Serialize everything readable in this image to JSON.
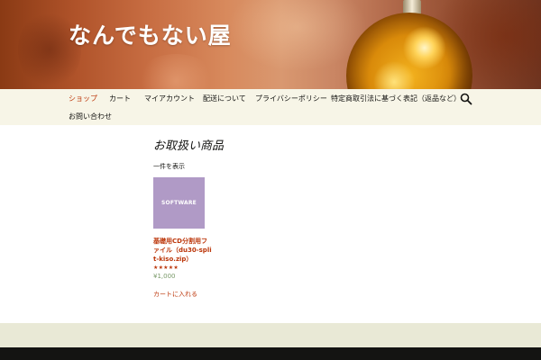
{
  "site": {
    "title": "なんでもない屋"
  },
  "nav": {
    "items": [
      {
        "label": "ショップ",
        "active": true
      },
      {
        "label": "カート"
      },
      {
        "label": "マイアカウント"
      },
      {
        "label": "配送について"
      },
      {
        "label": "プライバシーポリシー"
      },
      {
        "label": "特定商取引法に基づく表記（返品など）"
      },
      {
        "label": "お問い合わせ"
      }
    ],
    "search_icon": "search-icon"
  },
  "main": {
    "heading": "お取扱い商品",
    "result_count": "一件を表示",
    "products": [
      {
        "thumb_text": "SOFTWARE",
        "title": "基礎用CD分割用ファイル（du30-split-kiso.zip）",
        "rating_stars": "★★★★★",
        "rating_value": 5,
        "price": "¥1,000",
        "add_to_cart": "カートに入れる"
      }
    ]
  },
  "colors": {
    "accent": "#bc360a",
    "nav_bg": "#f7f5e7",
    "footer_widgets_bg": "#e9e9d6",
    "footer_bg": "#141412",
    "thumb_bg": "#b09ac6"
  }
}
